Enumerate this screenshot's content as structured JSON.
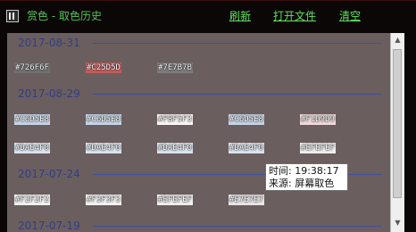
{
  "window": {
    "title": "赏色 - 取色历史",
    "actions": [
      "刷新",
      "打开文件",
      "清空"
    ]
  },
  "history": [
    {
      "date": "2017-08-31",
      "colors": [
        {
          "hex": "#726F6F",
          "bg": "#726F6F"
        },
        {
          "hex": "#C25D5D",
          "bg": "#C25D5D"
        },
        {
          "hex": "#7E7B7B",
          "bg": "#7E7B7B"
        }
      ]
    },
    {
      "date": "2017-08-29",
      "colors": [
        {
          "hex": "#C6D5E8",
          "bg": "#C6D5E8"
        },
        {
          "hex": "#C6D5E8",
          "bg": "#C6D5E8"
        },
        {
          "hex": "#FBF5F3",
          "bg": "#FBF5F3"
        },
        {
          "hex": "#C6D5E8",
          "bg": "#C6D5E8"
        },
        {
          "hex": "#F1D9D9",
          "bg": "#F1D9D9"
        },
        {
          "hex": "#DAE4F0",
          "bg": "#DAE4F0"
        },
        {
          "hex": "#DAE4F0",
          "bg": "#DAE4F0"
        },
        {
          "hex": "#DAE4F0",
          "bg": "#DAE4F0"
        },
        {
          "hex": "#DAE4F0",
          "bg": "#DAE4F0"
        },
        {
          "hex": "#EFEFEF",
          "bg": "#EFEFEF"
        }
      ]
    },
    {
      "date": "2017-07-24",
      "colors": [
        {
          "hex": "#F2F2F2",
          "bg": "#F2F2F2"
        },
        {
          "hex": "#F3F3F3",
          "bg": "#F3F3F3"
        },
        {
          "hex": "#EFEFEF",
          "bg": "#EFEFEF"
        },
        {
          "hex": "#E7E7E7",
          "bg": "#E7E7E7"
        }
      ]
    },
    {
      "date": "2017-07-19",
      "colors": []
    }
  ],
  "tooltip": {
    "time_line": "时间: 19:38:17",
    "source_line": "来源: 屏幕取色"
  },
  "theme": {
    "title_color": "#56C156",
    "link_color": "#5FE05F",
    "list_bg": "#6B5E5E",
    "date_color": "#2F3F86"
  }
}
